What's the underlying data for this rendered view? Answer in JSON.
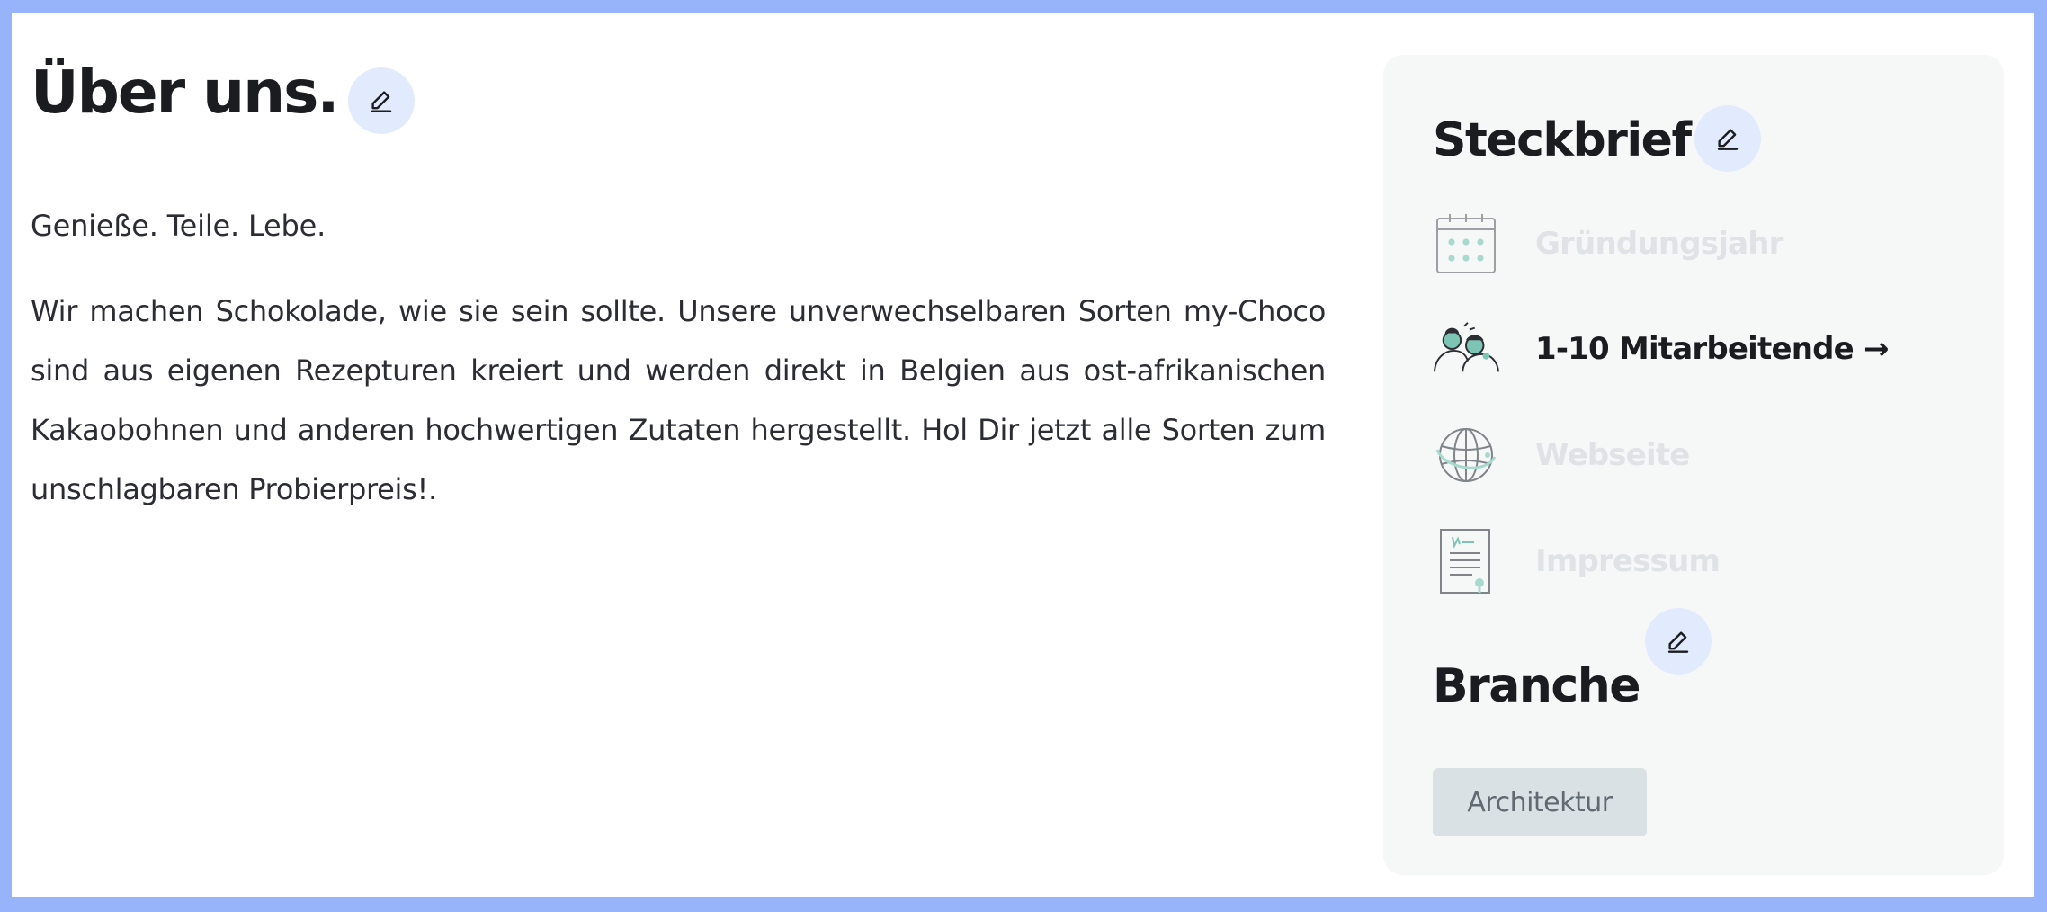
{
  "about": {
    "title": "Über uns.",
    "slogan": "Genieße. Teile. Lebe.",
    "text": "Wir machen Schokolade, wie sie sein sollte. Unsere unverwechselbaren Sorten my-Choco sind aus eigenen Rezepturen kreiert und werden direkt in Belgien aus ost-afrikanischen Kakaobohnen und anderen hochwertigen Zutaten hergestellt. Hol Dir jetzt alle Sorten zum unschlagbaren Probierpreis!."
  },
  "profile": {
    "title": "Steckbrief",
    "facts": [
      {
        "icon": "calendar-icon",
        "label": "Gründungsjahr",
        "state": "empty"
      },
      {
        "icon": "team-icon",
        "label": "1-10 Mitarbeitende →",
        "state": "filled"
      },
      {
        "icon": "globe-icon",
        "label": "Webseite",
        "state": "empty"
      },
      {
        "icon": "document-icon",
        "label": "Impressum",
        "state": "empty"
      }
    ]
  },
  "industry": {
    "title": "Branche",
    "tags": [
      "Architektur"
    ]
  },
  "icons": {
    "edit": "pencil-icon"
  },
  "colors": {
    "frame_border": "#97b4fa",
    "edit_button_bg": "#e2ebfd",
    "card_bg": "#f6f8f8",
    "muted_label": "#dfe3e6",
    "icon_accent": "#7cc4b4",
    "tag_bg": "#dae1e4",
    "tag_text": "#5f6a71"
  }
}
